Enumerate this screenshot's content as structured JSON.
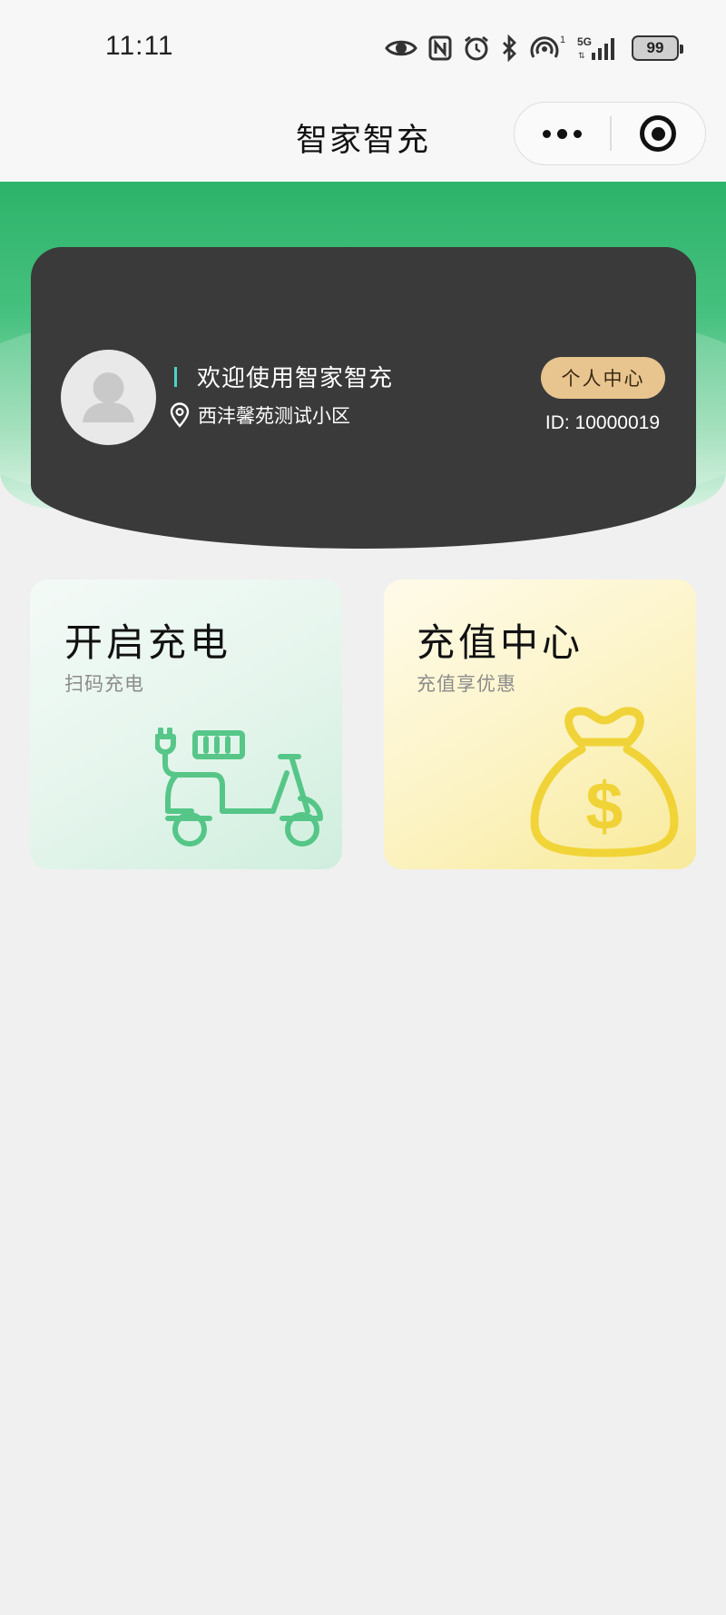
{
  "status_bar": {
    "time": "11:11",
    "network": "5G",
    "signal_sup": "1",
    "battery": "99",
    "icons": [
      "eye-icon",
      "nfc-icon",
      "alarm-icon",
      "bluetooth-icon",
      "hotspot-icon",
      "signal-icon",
      "battery-icon"
    ]
  },
  "header": {
    "title": "智家智充",
    "capsule_icons": [
      "more-icon",
      "target-icon"
    ]
  },
  "user_card": {
    "welcome": "欢迎使用智家智充",
    "location": "西沣馨苑测试小区",
    "profile_button": "个人中心",
    "user_id": "ID: 10000019"
  },
  "features": [
    {
      "title": "开启充电",
      "subtitle": "扫码充电",
      "icon": "scooter-charging-icon",
      "color": "#3fbf78"
    },
    {
      "title": "充值中心",
      "subtitle": "充值享优惠",
      "icon": "money-bag-icon",
      "color": "#efd02a"
    }
  ],
  "colors": {
    "brand_green": "#2db36a",
    "card_dark": "#3a3a3a",
    "profile_gold": "#e8c48f",
    "accent_cyan": "#4fd1c5"
  }
}
